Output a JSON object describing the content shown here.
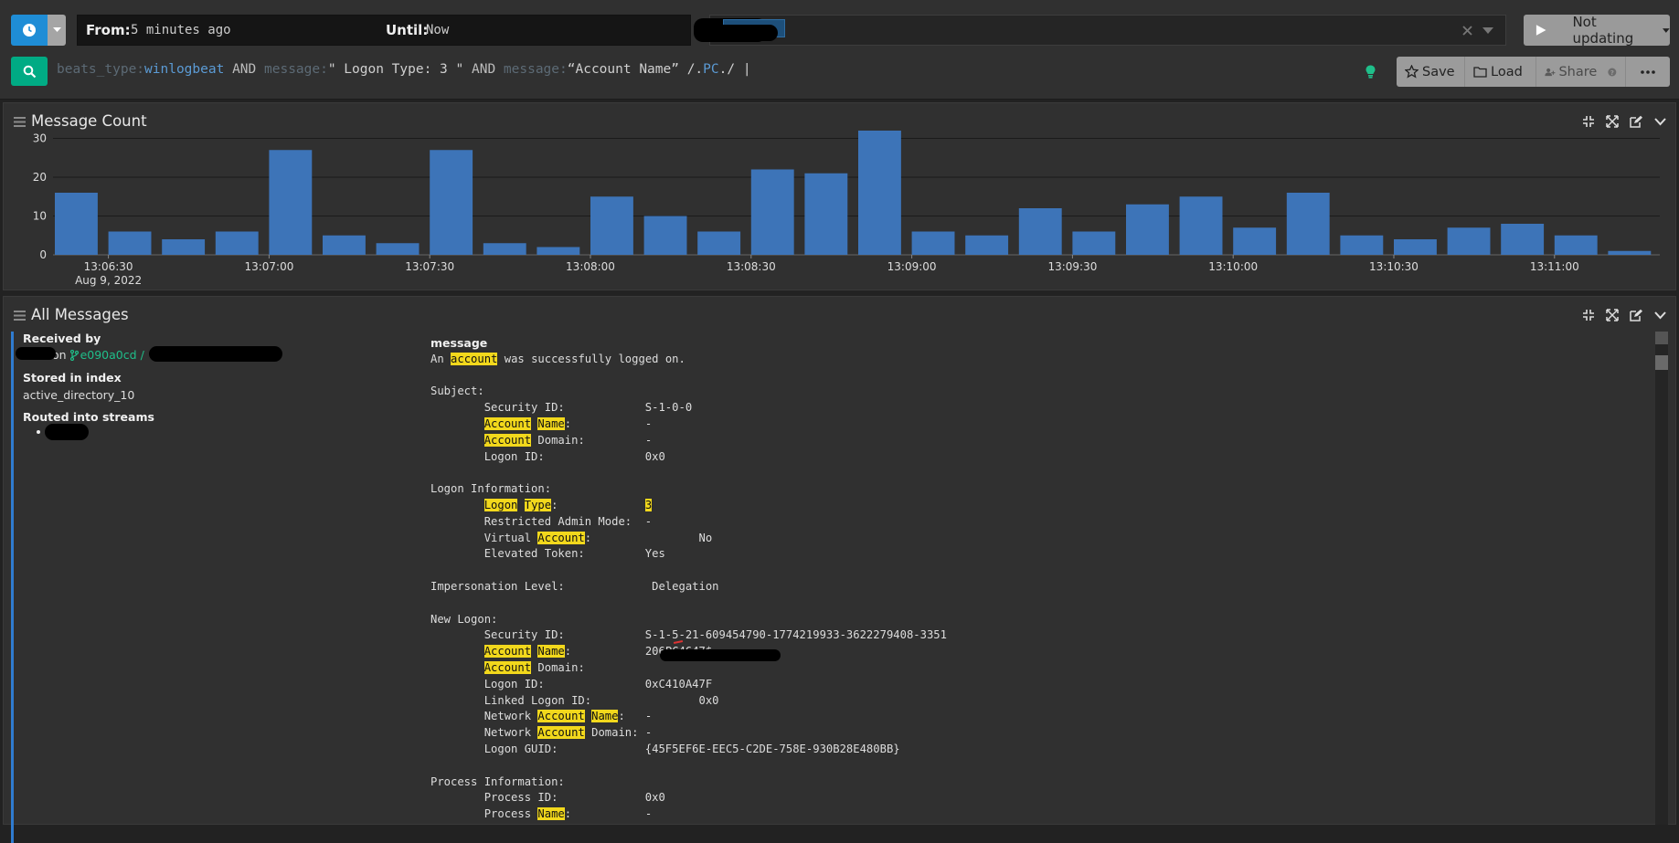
{
  "timerange": {
    "from_label": "From:",
    "from_value": "5 minutes ago",
    "until_label": "Until:",
    "until_value": "Now"
  },
  "refresh": {
    "label": "Not updating"
  },
  "query": {
    "p1_field": "beats_type:",
    "p1_value": "winlogbeat",
    "p2_op": " AND ",
    "p3_field": "message:",
    "p3_value": "\" Logon Type: 3 \"",
    "p4_op": " AND ",
    "p5_field": "message:",
    "p5_value": "“Account Name”",
    "p6_regex_a": " /.",
    "p6_regex_b": "PC",
    "p6_regex_c": "./ |"
  },
  "search_actions": {
    "save_label": "Save",
    "load_label": "Load",
    "share_label": "Share"
  },
  "colors": {
    "accent_blue": "#1f8dd6",
    "search_green": "#00ab84",
    "bar": "#3d74b8",
    "highlight": "#f2d81c"
  },
  "widgets": {
    "message_count_title": "Message Count",
    "all_messages_title": "All Messages"
  },
  "chart_data": {
    "type": "bar",
    "title": "Message Count",
    "ylim": [
      0,
      32
    ],
    "yticks": [
      0,
      10,
      20,
      30
    ],
    "values": [
      16,
      6,
      4,
      6,
      27,
      5,
      3,
      27,
      3,
      2,
      15,
      10,
      6,
      22,
      21,
      32,
      6,
      5,
      12,
      6,
      13,
      15,
      7,
      16,
      5,
      4,
      7,
      8,
      5,
      1
    ],
    "xtick_labels": [
      "13:06:30",
      "13:07:00",
      "13:07:30",
      "13:08:00",
      "13:08:30",
      "13:09:00",
      "13:09:30",
      "13:10:00",
      "13:10:30",
      "13:11:00"
    ],
    "date_label": "Aug 9, 2022",
    "grid": true
  },
  "message": {
    "received_by_label": "Received by",
    "received_by_value_a": "on",
    "received_by_id": "e090a0cd",
    "received_by_sep": "/",
    "stored_label": "Stored in index",
    "stored_value": "active_directory_10",
    "routed_label": "Routed into streams",
    "field_label": "message",
    "lines": [
      [
        [
          "An ",
          false
        ],
        [
          "account",
          true
        ],
        [
          " was successfully logged on.",
          false
        ]
      ],
      [],
      [
        [
          "Subject:",
          false
        ]
      ],
      [
        [
          "        Security ID:            S-1-0-0",
          false
        ]
      ],
      [
        [
          "        ",
          false
        ],
        [
          "Account",
          true
        ],
        [
          " ",
          false
        ],
        [
          "Name",
          true
        ],
        [
          ":           -",
          false
        ]
      ],
      [
        [
          "        ",
          false
        ],
        [
          "Account",
          true
        ],
        [
          " Domain:         -",
          false
        ]
      ],
      [
        [
          "        Logon ID:               0x0",
          false
        ]
      ],
      [],
      [
        [
          "Logon Information:",
          false
        ]
      ],
      [
        [
          "        ",
          false
        ],
        [
          "Logon",
          true
        ],
        [
          " ",
          false
        ],
        [
          "Type",
          true
        ],
        [
          ":             ",
          false
        ],
        [
          "3",
          true
        ]
      ],
      [
        [
          "        Restricted Admin Mode:  -",
          false
        ]
      ],
      [
        [
          "        Virtual ",
          false
        ],
        [
          "Account",
          true
        ],
        [
          ":                ",
          false
        ],
        [
          "No",
          false
        ]
      ],
      [
        [
          "        Elevated Token:         Yes",
          false
        ]
      ],
      [],
      [
        [
          "Impersonation Level:             Delegation",
          false
        ]
      ],
      [],
      [
        [
          "New Logon:",
          false
        ]
      ],
      [
        [
          "        Security ID:            S-1-5-21-609454790-1774219933-3622279408-3351",
          false
        ]
      ],
      [
        [
          "        ",
          false
        ],
        [
          "Account",
          true
        ],
        [
          " ",
          false
        ],
        [
          "Name",
          true
        ],
        [
          ":           206PC4647$",
          false
        ]
      ],
      [
        [
          "        ",
          false
        ],
        [
          "Account",
          true
        ],
        [
          " Domain:         ",
          false
        ]
      ],
      [
        [
          "        Logon ID:               0xC410A47F",
          false
        ]
      ],
      [
        [
          "        Linked Logon ID:                0x0",
          false
        ]
      ],
      [
        [
          "        Network ",
          false
        ],
        [
          "Account",
          true
        ],
        [
          " ",
          false
        ],
        [
          "Name",
          true
        ],
        [
          ":   -",
          false
        ]
      ],
      [
        [
          "        Network ",
          false
        ],
        [
          "Account",
          true
        ],
        [
          " Domain: -",
          false
        ]
      ],
      [
        [
          "        Logon GUID:             {45F5EF6E-EEC5-C2DE-758E-930B28E480BB}",
          false
        ]
      ],
      [],
      [
        [
          "Process Information:",
          false
        ]
      ],
      [
        [
          "        Process ID:             0x0",
          false
        ]
      ],
      [
        [
          "        Process ",
          false
        ],
        [
          "Name",
          true
        ],
        [
          ":           -",
          false
        ]
      ]
    ]
  }
}
